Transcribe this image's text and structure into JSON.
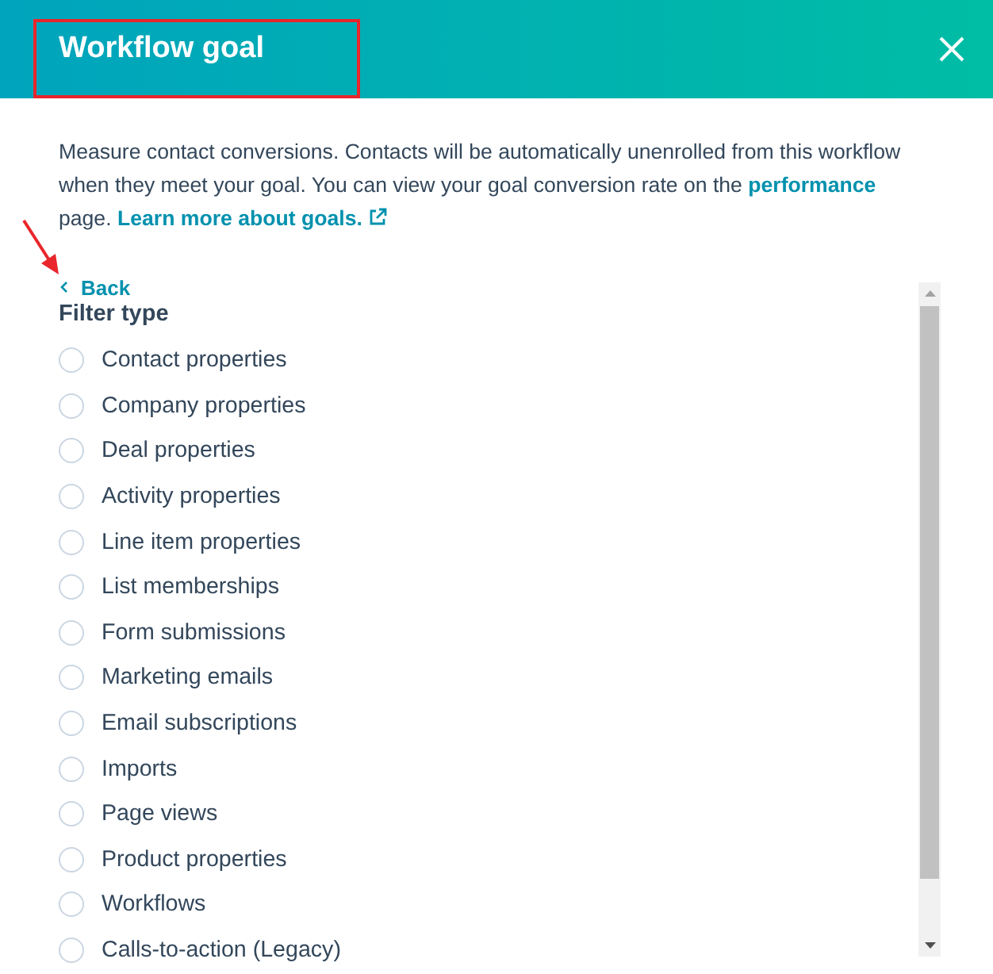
{
  "header": {
    "title": "Workflow goal"
  },
  "description": {
    "text": "Measure contact conversions. Contacts will be automatically unenrolled from this workflow when they meet your goal. You can view your goal conversion rate on the",
    "link": "performance",
    "text_after": "page.",
    "learn_more_link": "Learn more about goals."
  },
  "back_link": "Back",
  "filter_heading": "Filter type",
  "filter_options": [
    {
      "label": "Contact properties",
      "selected": false
    },
    {
      "label": "Company properties",
      "selected": false
    },
    {
      "label": "Deal properties",
      "selected": false
    },
    {
      "label": "Activity properties",
      "selected": false
    },
    {
      "label": "Line item properties",
      "selected": false
    },
    {
      "label": "List memberships",
      "selected": false
    },
    {
      "label": "Form submissions",
      "selected": false
    },
    {
      "label": "Marketing emails",
      "selected": false
    },
    {
      "label": "Email subscriptions",
      "selected": false
    },
    {
      "label": "Imports",
      "selected": false
    },
    {
      "label": "Page views",
      "selected": false
    },
    {
      "label": "Product properties",
      "selected": false
    },
    {
      "label": "Workflows",
      "selected": false
    },
    {
      "label": "Calls-to-action (Legacy)",
      "selected": false
    }
  ]
}
